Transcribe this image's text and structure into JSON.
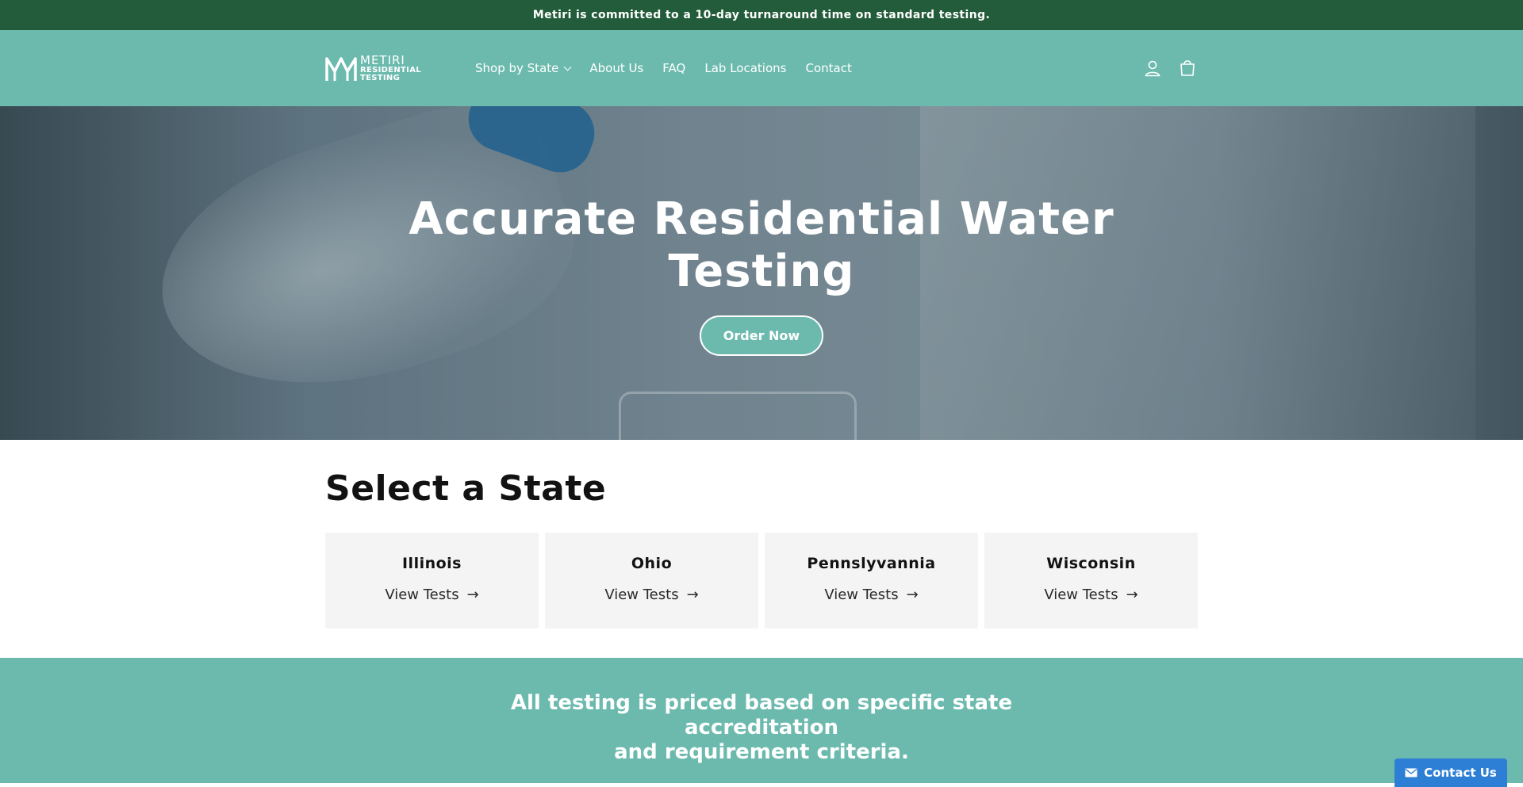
{
  "announcement": {
    "text": "Metiri is committed to a 10-day turnaround time on standard testing."
  },
  "header": {
    "logo": {
      "line1": "METIRI",
      "line2": "RESIDENTIAL",
      "line3": "TESTING"
    },
    "nav": [
      {
        "label": "Shop by State",
        "has_dropdown": true
      },
      {
        "label": "About Us"
      },
      {
        "label": "FAQ"
      },
      {
        "label": "Lab Locations"
      },
      {
        "label": "Contact"
      }
    ],
    "icons": [
      "account-icon",
      "cart-icon"
    ]
  },
  "hero": {
    "title_line1": "Accurate Residential Water",
    "title_line2": "Testing",
    "button": "Order Now"
  },
  "states": {
    "title": "Select a State",
    "cards": [
      {
        "name": "Illinois",
        "link": "View Tests"
      },
      {
        "name": "Ohio",
        "link": "View Tests"
      },
      {
        "name": "Pennslyvannia",
        "link": "View Tests"
      },
      {
        "name": "Wisconsin",
        "link": "View Tests"
      }
    ]
  },
  "banner": {
    "line1": "All testing is priced based on specific state accreditation",
    "line2": "and requirement criteria."
  },
  "contact_widget": {
    "label": "Contact Us",
    "icon": "envelope-icon"
  },
  "colors": {
    "announcement_bg": "#235c3a",
    "brand_teal": "#6cbaae",
    "contact_blue": "#2d7fd6"
  }
}
